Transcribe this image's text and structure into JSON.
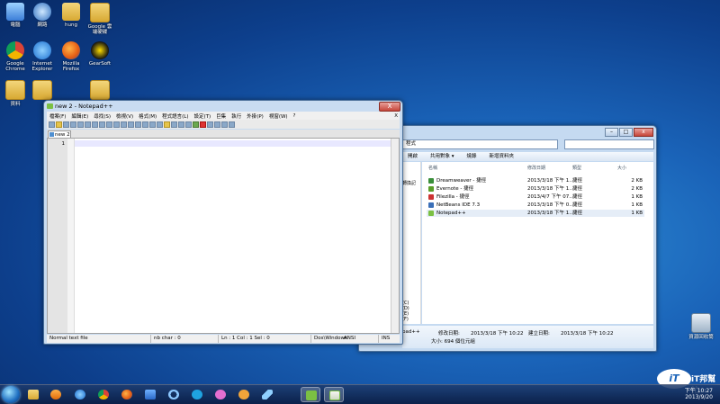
{
  "desktop": {
    "icons": [
      {
        "label": "電腦",
        "icon": "computer-icon"
      },
      {
        "label": "網路",
        "icon": "network-icon"
      },
      {
        "label": "hung",
        "icon": "user-folder-icon"
      },
      {
        "label": "Google 雲端硬碟",
        "icon": "google-drive-icon"
      },
      {
        "label": "Google Chrome",
        "icon": "chrome-icon"
      },
      {
        "label": "Internet Explorer",
        "icon": "ie-icon"
      },
      {
        "label": "Mozilla Firefox",
        "icon": "firefox-icon"
      },
      {
        "label": "GearSoft",
        "icon": "gear-icon"
      },
      {
        "label": "資料",
        "icon": "folder-icon"
      },
      {
        "label": "",
        "icon": "folder-icon"
      },
      {
        "label": "",
        "icon": "folder-icon"
      },
      {
        "label": "資源回收筒",
        "icon": "recycle-bin-icon"
      }
    ]
  },
  "notepad": {
    "title": "new 2 - Notepad++",
    "close": "X",
    "menu": [
      "檔案(F)",
      "編輯(E)",
      "尋找(S)",
      "檢視(V)",
      "格式(M)",
      "程式語言(L)",
      "設定(T)",
      "巨集",
      "執行",
      "外掛(P)",
      "視窗(W)",
      "?"
    ],
    "menu_close": "X",
    "tab": "new 2",
    "line_number": "1",
    "status": {
      "type": "Normal text file",
      "chars": "nb char : 0",
      "pos": "Ln : 1   Col : 1   Sel : 0",
      "eol": "Dos\\Windows",
      "enc": "ANSI",
      "mode": "INS"
    }
  },
  "explorer": {
    "address": "程式",
    "commands": [
      "開啟",
      "共用對象 ▾",
      "燒錄",
      "新增資料夾"
    ],
    "columns": [
      "名稱",
      "修改日期",
      "類型",
      "大小"
    ],
    "nav": [
      "轉換記",
      "(C)",
      "(D)",
      "(E)",
      "(F)",
      "(G)"
    ],
    "files": [
      {
        "name": "Dreamweaver - 捷徑",
        "date": "2013/3/18 下午 1...",
        "type": "捷徑",
        "size": "2 KB",
        "color": "#3a8f3a"
      },
      {
        "name": "Evernote - 捷徑",
        "date": "2013/3/18 下午 1...",
        "type": "捷徑",
        "size": "2 KB",
        "color": "#5a9f2a"
      },
      {
        "name": "Filezilla - 捷徑",
        "date": "2013/4/7 下午 07...",
        "type": "捷徑",
        "size": "1 KB",
        "color": "#c33"
      },
      {
        "name": "NetBeans IDE 7.3",
        "date": "2013/3/18 下午 0...",
        "type": "捷徑",
        "size": "1 KB",
        "color": "#3a6fb8"
      },
      {
        "name": "Notepad++",
        "date": "2013/3/18 下午 1...",
        "type": "捷徑",
        "size": "1 KB",
        "color": "#7bc043"
      }
    ],
    "details": {
      "name_tail": "pad++",
      "modified_label": "修改日期:",
      "modified": "2013/3/18 下午 10:22",
      "created_label": "建立日期:",
      "created": "2013/3/18 下午 10:22",
      "size_line": "大小: 694 個位元組"
    }
  },
  "taskbar": {
    "apps": [
      "explorer-icon",
      "media-player-icon",
      "ie-icon",
      "chrome-icon",
      "firefox-icon",
      "chat-icon",
      "refresh-icon",
      "skype-icon",
      "pig-icon",
      "monkey-icon",
      "plane-icon",
      "android-icon",
      "notepadpp-icon"
    ],
    "time": "下午 10:27",
    "date": "2013/9/20"
  },
  "watermark": "iT邦幫忙"
}
